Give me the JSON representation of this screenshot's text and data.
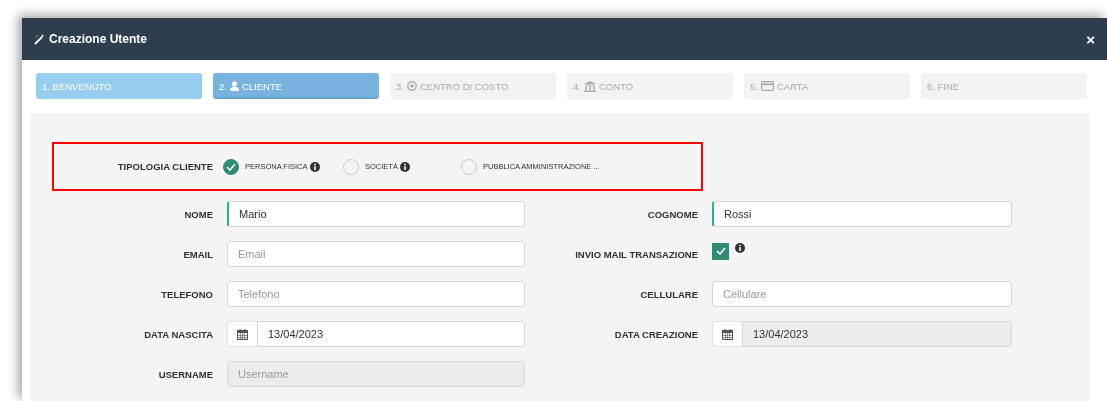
{
  "window": {
    "title": "Creazione Utente",
    "close": "×"
  },
  "steps": [
    {
      "label": "1. BENVENUTO",
      "selected": false
    },
    {
      "label": "2.",
      "label2": "CLIENTE",
      "selected": true
    },
    {
      "label": "3.",
      "label2": "CENTRO DI COSTO",
      "selected": false
    },
    {
      "label": "4.",
      "label2": "CONTO",
      "selected": false
    },
    {
      "label": "5.",
      "label2": "CARTA",
      "selected": false
    },
    {
      "label": "6. FINE",
      "selected": false
    }
  ],
  "client_type": {
    "label": "TIPOLOGIA CLIENTE",
    "options": [
      {
        "label": "PERSONA FISICA",
        "info": true,
        "selected": true
      },
      {
        "label": "SOCIETÀ",
        "info": true,
        "selected": false
      },
      {
        "label": "PUBBLICA AMMINISTRAZIONE ...",
        "info": false,
        "selected": false
      }
    ]
  },
  "fields": [
    {
      "label": "NOME",
      "kind": "text",
      "value": "Mario",
      "valid": true,
      "disabled": false
    },
    {
      "label": "COGNOME",
      "kind": "text",
      "value": "Rossi",
      "valid": true,
      "disabled": false
    },
    {
      "label": "EMAIL",
      "kind": "text",
      "placeholder": "Email",
      "valid": false,
      "disabled": false
    },
    {
      "label": "INVIO MAIL TRANSAZIONE",
      "kind": "checkbox",
      "checked": true,
      "info": true
    },
    {
      "label": "TELEFONO",
      "kind": "text",
      "placeholder": "Telefono",
      "valid": false,
      "disabled": false
    },
    {
      "label": "CELLULARE",
      "kind": "text",
      "placeholder": "Cellulare",
      "valid": false,
      "disabled": false
    },
    {
      "label": "DATA NASCITA",
      "kind": "date",
      "value": "13/04/2023",
      "valid": false,
      "disabled": false
    },
    {
      "label": "DATA CREAZIONE",
      "kind": "date",
      "value": "13/04/2023",
      "valid": false,
      "disabled": true
    },
    {
      "label": "USERNAME",
      "kind": "text",
      "placeholder": "Username",
      "valid": false,
      "disabled": true
    }
  ]
}
